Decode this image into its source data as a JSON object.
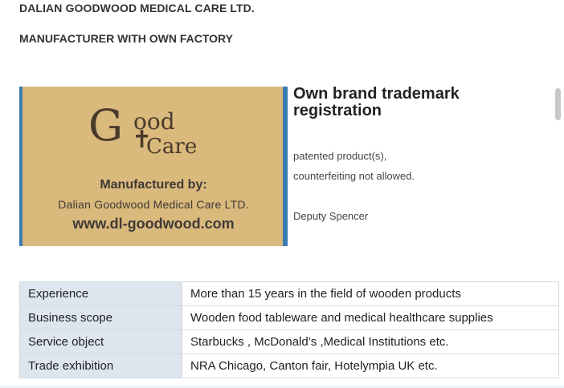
{
  "header": {
    "company_name": "DALIAN GOODWOOD MEDICAL CARE LTD.",
    "tagline": "MANUFACTURER WITH OWN FACTORY"
  },
  "photo": {
    "logo_g": "G",
    "logo_ood": "ood",
    "logo_care": "Care",
    "manufactured_by": "Manufactured by:",
    "maker": "Dalian Goodwood Medical Care LTD.",
    "website": "www.dl-goodwood.com"
  },
  "trademark": {
    "title": "Own brand trademark registration",
    "line1": "patented product(s),",
    "line2": "counterfeiting not allowed.",
    "signer": "Deputy Spencer"
  },
  "info_rows": [
    {
      "label": "Experience",
      "value": "More than 15 years in the field of wooden products"
    },
    {
      "label": "Business scope",
      "value": "Wooden food tableware and medical healthcare supplies"
    },
    {
      "label": "Service object",
      "value": "Starbucks , McDonald’s ,Medical Institutions etc."
    },
    {
      "label": "Trade exhibition",
      "value": "NRA Chicago, Canton fair, Hotelympia UK etc."
    }
  ],
  "colors": {
    "label_cell_bg": "#dde5ef",
    "photo_bg": "#d9b97c",
    "photo_edge": "#3a7bb0"
  }
}
